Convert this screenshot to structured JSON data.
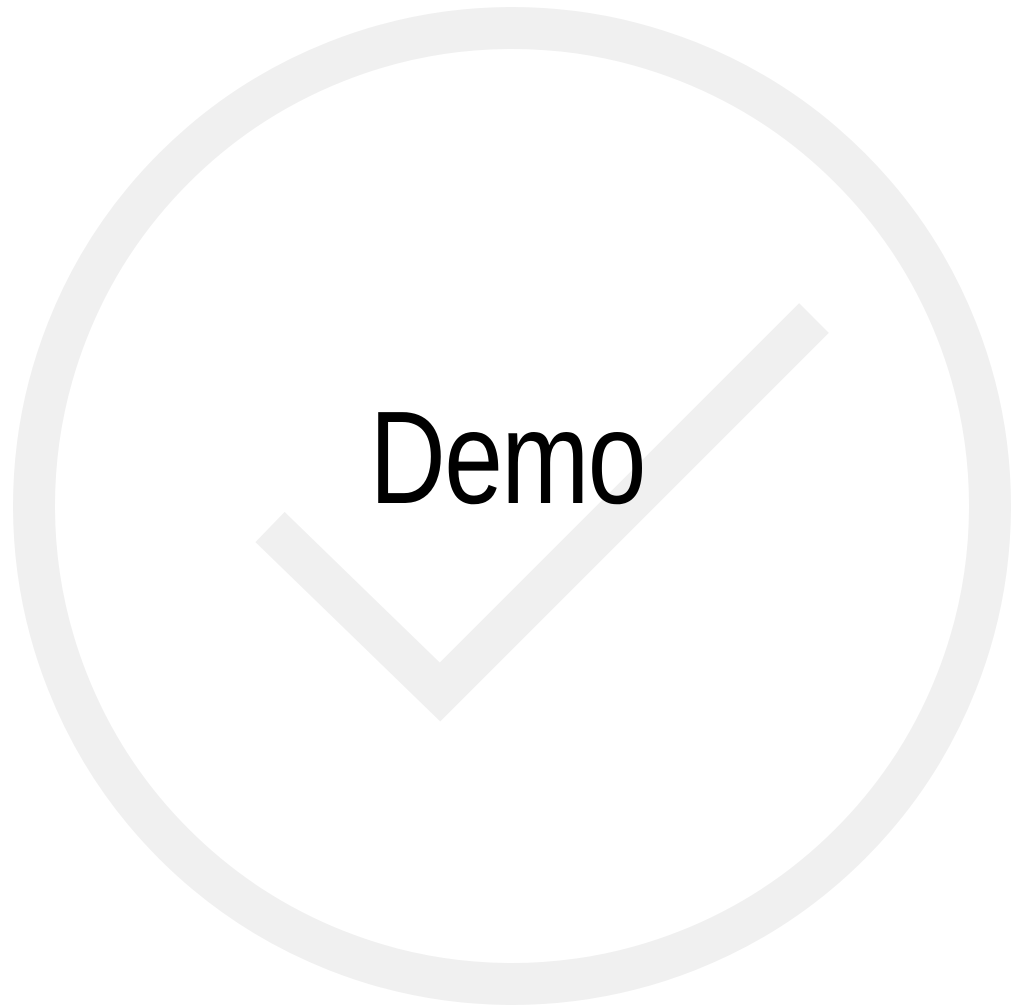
{
  "label": "Demo",
  "icon": "check-circle-icon",
  "colors": {
    "background": "#ffffff",
    "icon_stroke": "#f0f0f0",
    "text": "#000000"
  }
}
